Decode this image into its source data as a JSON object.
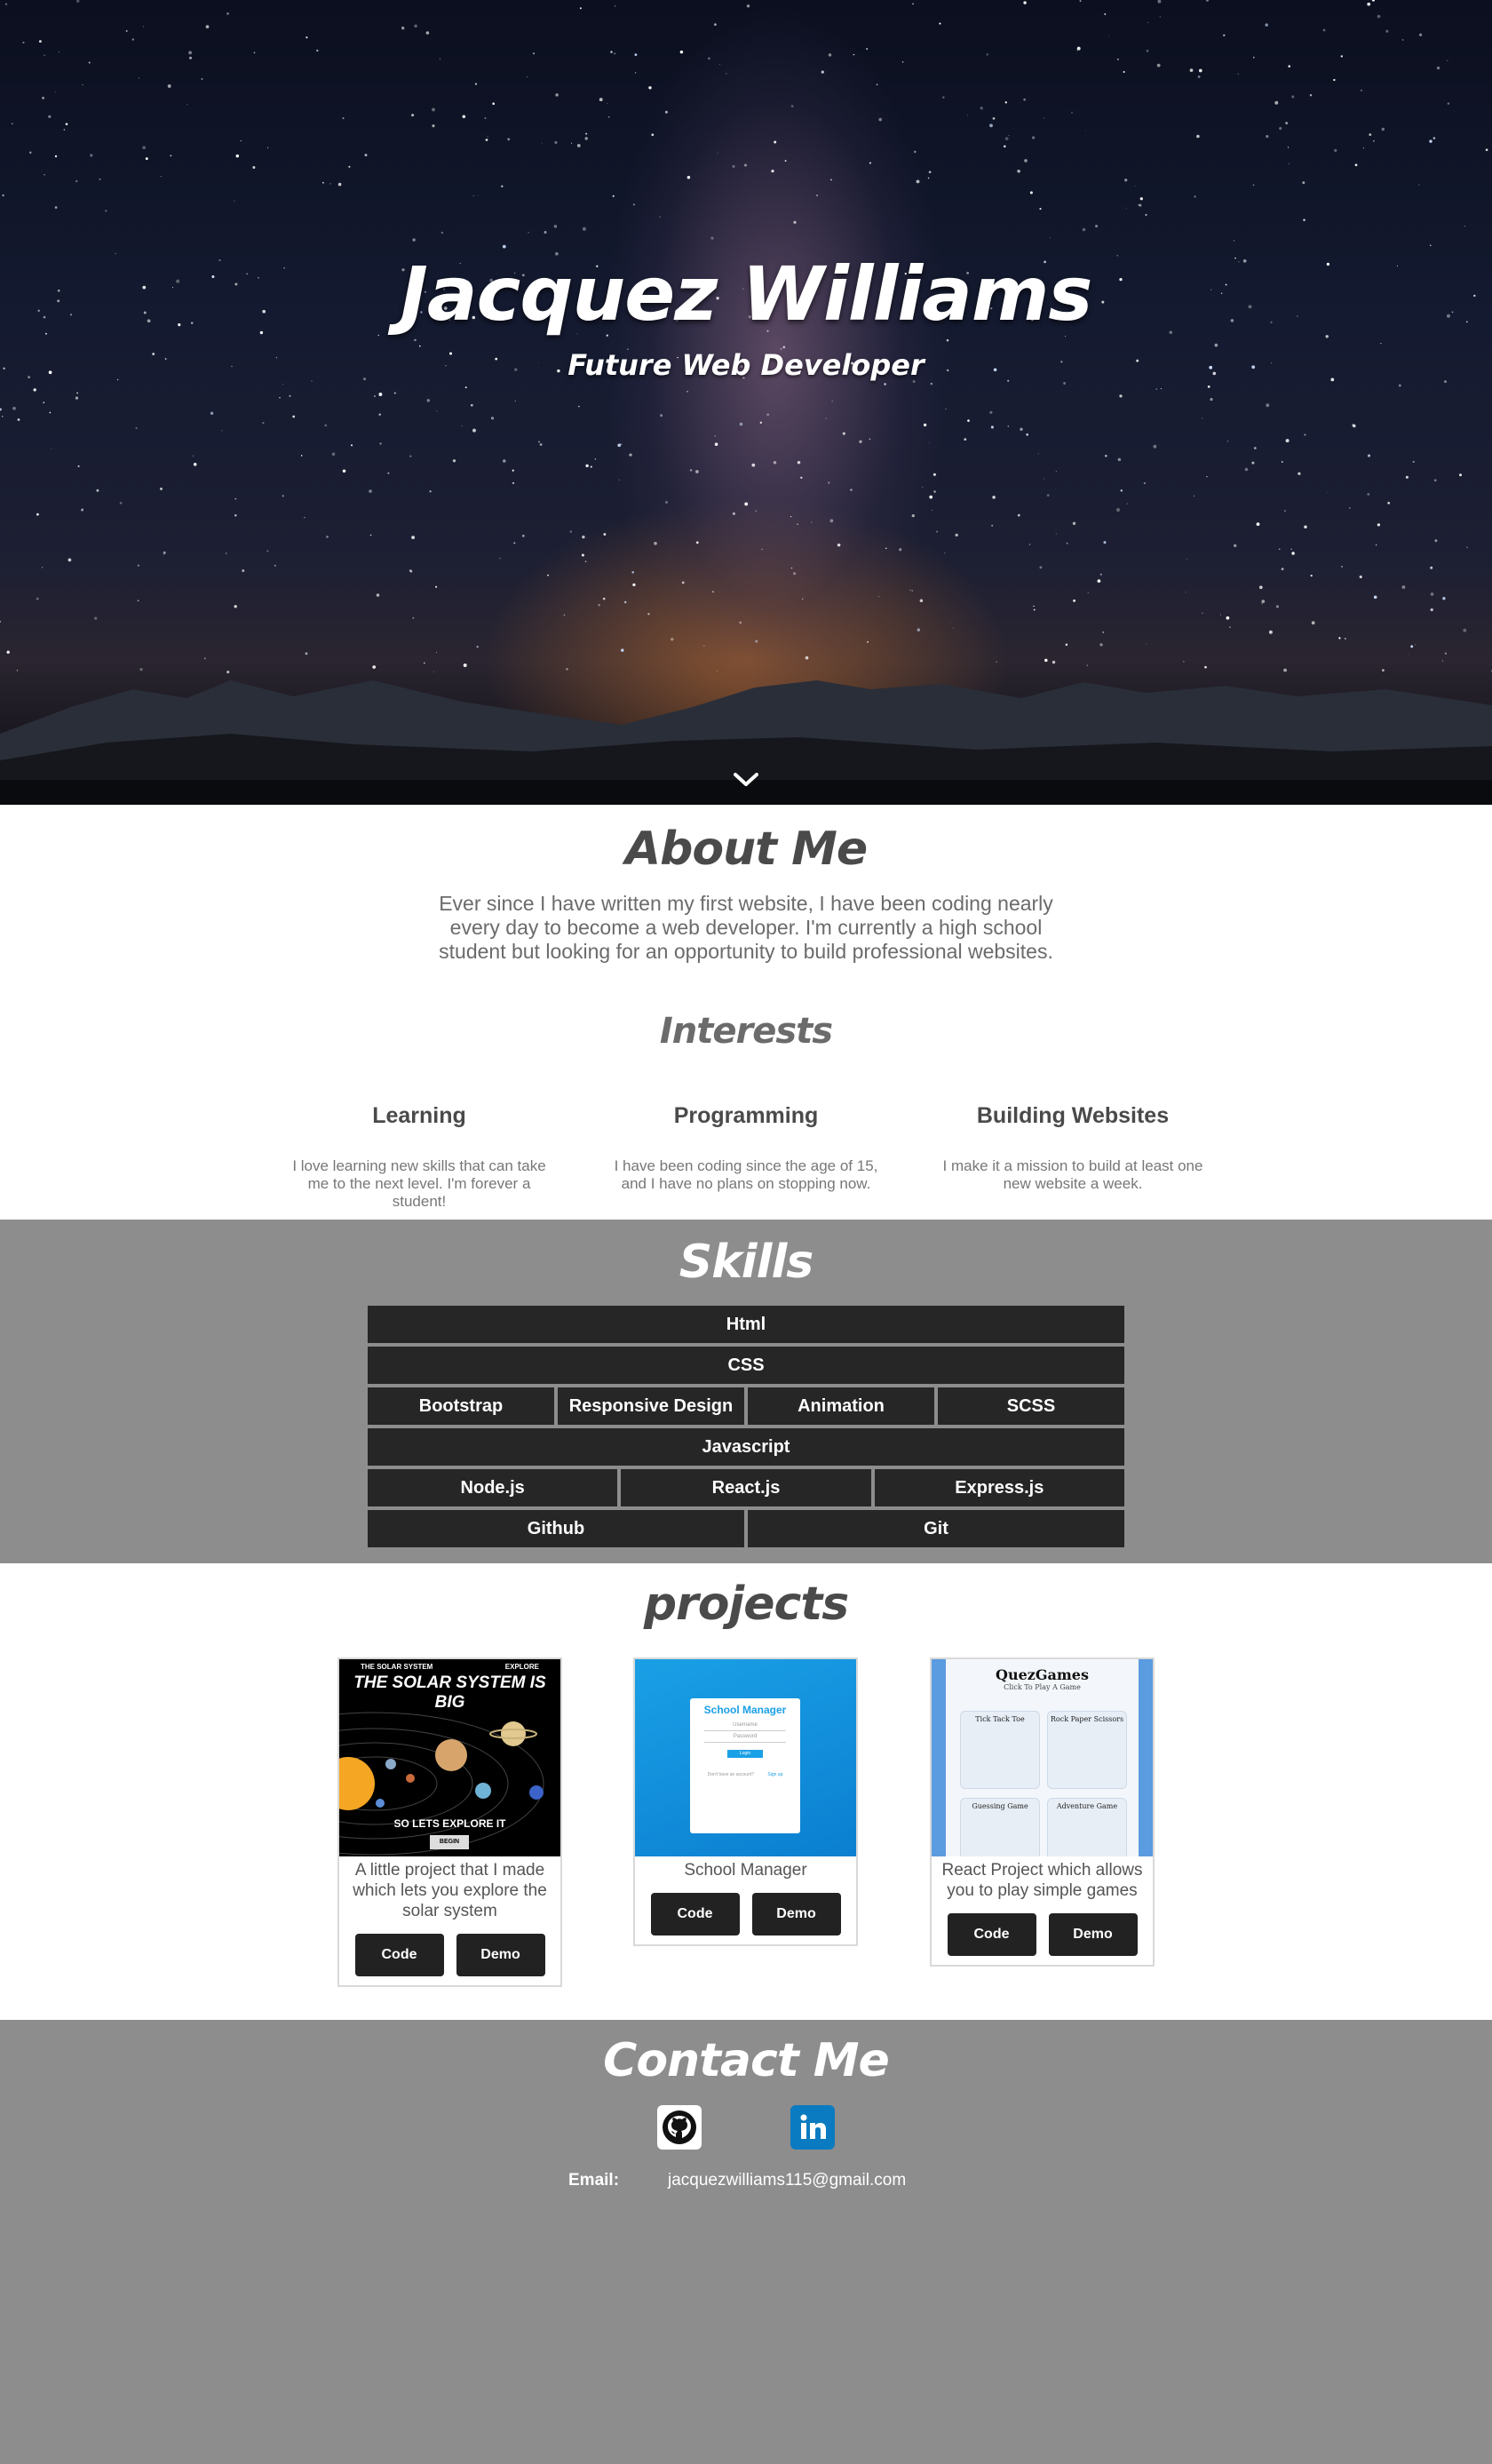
{
  "hero": {
    "title": "Jacquez Williams",
    "subtitle": "Future Web Developer",
    "scroll_icon": "chevron-down-icon"
  },
  "about": {
    "heading": "About Me",
    "text": "Ever since I have written my first website, I have been coding nearly every day to become a web developer. I'm currently a high school student but looking for an opportunity to build professional websites.",
    "interests_heading": "Interests",
    "interests": [
      {
        "title": "Learning",
        "text": "I love learning new skills that can take me to the next level. I'm forever a student!"
      },
      {
        "title": "Programming",
        "text": "I have been coding since the age of 15, and I have no plans on stopping now."
      },
      {
        "title": "Building Websites",
        "text": "I make it a mission to build at least one new website a week."
      }
    ]
  },
  "skills": {
    "heading": "Skills",
    "rows": [
      [
        "Html"
      ],
      [
        "CSS"
      ],
      [
        "Bootstrap",
        "Responsive Design",
        "Animation",
        "SCSS"
      ],
      [
        "Javascript"
      ],
      [
        "Node.js",
        "React.js",
        "Express.js"
      ],
      [
        "Github",
        "Git"
      ]
    ]
  },
  "projects": {
    "heading": "projects",
    "items": [
      {
        "description": "A little project that I made which lets you explore the solar system",
        "code_label": "Code",
        "demo_label": "Demo",
        "image": {
          "top_left": "THE SOLAR SYSTEM",
          "top_right": "EXPLORE",
          "headline": "THE SOLAR SYSTEM IS BIG",
          "tagline": "SO LETS EXPLORE IT",
          "button": "BEGIN"
        }
      },
      {
        "description": "School Manager",
        "code_label": "Code",
        "demo_label": "Demo",
        "image": {
          "title": "School Manager",
          "field1": "Username",
          "field2": "Password",
          "button": "Login",
          "footer_left": "Don't have an account?",
          "footer_right": "Sign up"
        }
      },
      {
        "description": "React Project which allows you to play simple games",
        "code_label": "Code",
        "demo_label": "Demo",
        "image": {
          "title": "QuezGames",
          "subtitle": "Click To Play A Game",
          "tiles": [
            "Tick Tack Toe",
            "Rock Paper Scissors",
            "Guessing Game",
            "Adventure Game"
          ]
        }
      }
    ]
  },
  "contact": {
    "heading": "Contact Me",
    "github_icon": "github-icon",
    "linkedin_icon": "linkedin-icon",
    "email_label": "Email:",
    "email": "jacquezwilliams115@gmail.com"
  },
  "colors": {
    "dark_section": "#8d8d8d",
    "skill_bg": "#262626",
    "button_bg": "#222222",
    "linkedin": "#0a7bc0"
  }
}
